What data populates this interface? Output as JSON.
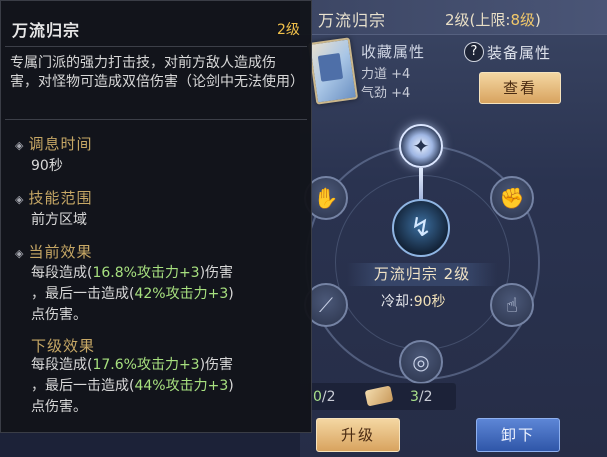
{
  "header": {
    "title": "万流归宗",
    "level_text": "2级(上限:",
    "level_cap": "8级",
    "level_close": ")"
  },
  "collection": {
    "title": "收藏属性",
    "stats": [
      "力道 +4",
      "气劲 +4"
    ]
  },
  "equip": {
    "help_glyph": "?",
    "label": "装备属性",
    "view_button": "查看"
  },
  "wheel": {
    "skill_name": "万流归宗  2级",
    "cooldown_label": "冷却:",
    "cooldown_value": "90秒",
    "counts": {
      "left_have": "0",
      "left_total": "/2",
      "right_have": "3",
      "right_total": "/2"
    }
  },
  "buttons": {
    "upgrade": "升级",
    "unequip": "卸下"
  },
  "tooltip": {
    "title": "万流归宗",
    "level": "2级",
    "description": "专属门派的强力打击技，对前方敌人造成伤害，对怪物可造成双倍伤害（论剑中无法使用）",
    "sections": {
      "cooldown_title": "调息时间",
      "cooldown_value": "90秒",
      "range_title": "技能范围",
      "range_value": "前方区域",
      "current_title": "当前效果",
      "next_title": "下级效果"
    },
    "current_effect": {
      "p1": "每段造成(",
      "v1": "16.8%攻击力+3",
      "p2": ")伤害",
      "p3": "，最后一击造成(",
      "v2": "42%攻击力+3",
      "p4": ")",
      "p5": "点伤害。"
    },
    "next_effect": {
      "p1": "每段造成(",
      "v1": "17.6%攻击力+3",
      "p2": ")伤害",
      "p3": "，最后一击造成(",
      "v2": "44%攻击力+3",
      "p4": ")",
      "p5": "点伤害。"
    }
  },
  "colors": {
    "accent_gold": "#f0c04a",
    "section_gold": "#c6a765",
    "value_green": "#a7e07f",
    "button_gold": "#d8a35f",
    "button_blue": "#2f56a8"
  }
}
